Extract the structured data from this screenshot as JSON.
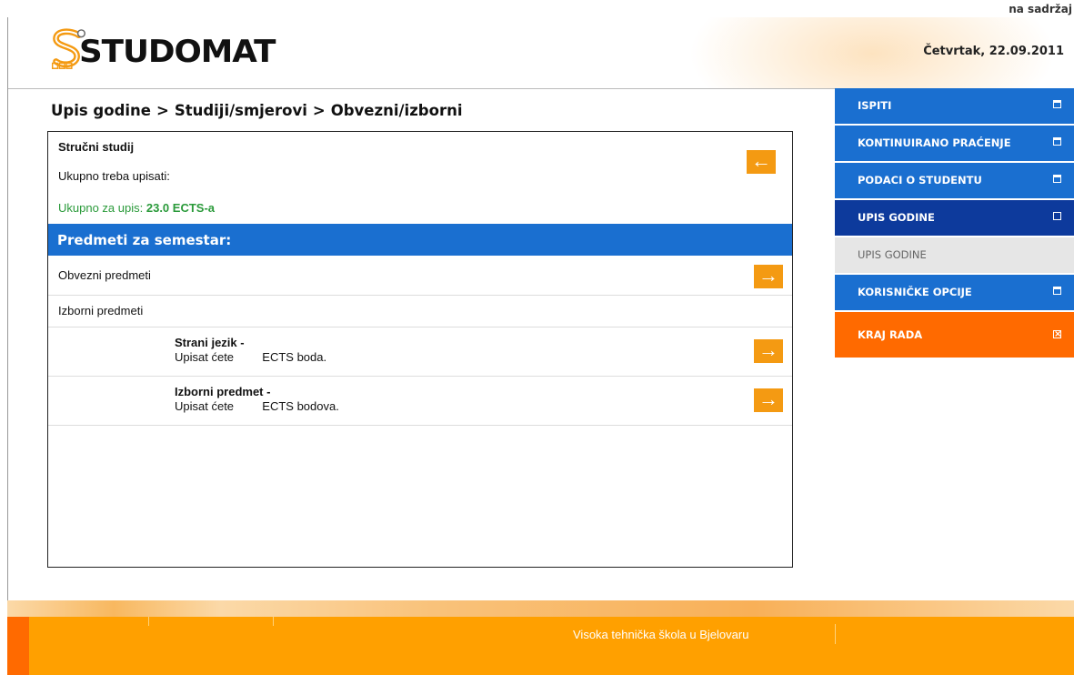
{
  "skip_link": "na sadržaj",
  "header": {
    "logo_text": "STUDOMAT",
    "date": "Četvrtak, 22.09.2011"
  },
  "breadcrumb": [
    "Upis godine",
    "Studiji/smjerovi",
    "Obvezni/izborni"
  ],
  "breadcrumb_separator": ">",
  "panel": {
    "study_title": "Stručni studij",
    "need_label": "Ukupno treba upisati:",
    "total_label": "Ukupno za upis:",
    "total_value": "23.0 ECTS-a",
    "back_icon": "arrow-left-icon",
    "semester_header": "Predmeti za semestar:",
    "mandatory_label": "Obvezni predmeti",
    "elective_label": "Izborni predmeti",
    "sub_items": [
      {
        "title": "Strani jezik -",
        "prefix": "Upisat ćete",
        "suffix": "ECTS boda."
      },
      {
        "title": "Izborni predmet -",
        "prefix": "Upisat ćete",
        "suffix": "ECTS bodova."
      }
    ],
    "forward_icon": "arrow-right-icon"
  },
  "menu": [
    {
      "label": "ISPITI",
      "icon": "expand-icon"
    },
    {
      "label": "KONTINUIRANO PRAĆENJE",
      "icon": "expand-icon"
    },
    {
      "label": "PODACI O STUDENTU",
      "icon": "expand-icon"
    },
    {
      "label": "UPIS GODINE",
      "icon": "collapse-icon"
    },
    {
      "label": "UPIS GODINE",
      "icon": ""
    },
    {
      "label": "KORISNIČKE OPCIJE",
      "icon": "expand-icon"
    },
    {
      "label": "KRAJ RADA",
      "icon": "close-box-icon"
    }
  ],
  "footer": {
    "text": "Visoka tehnička škola u Bjelovaru"
  },
  "colors": {
    "menu_blue": "#1a6fd0",
    "menu_active": "#0d3a9c",
    "accent_orange": "#f49a12",
    "logout_orange": "#ff6a00",
    "total_green": "#2a9a3a"
  }
}
